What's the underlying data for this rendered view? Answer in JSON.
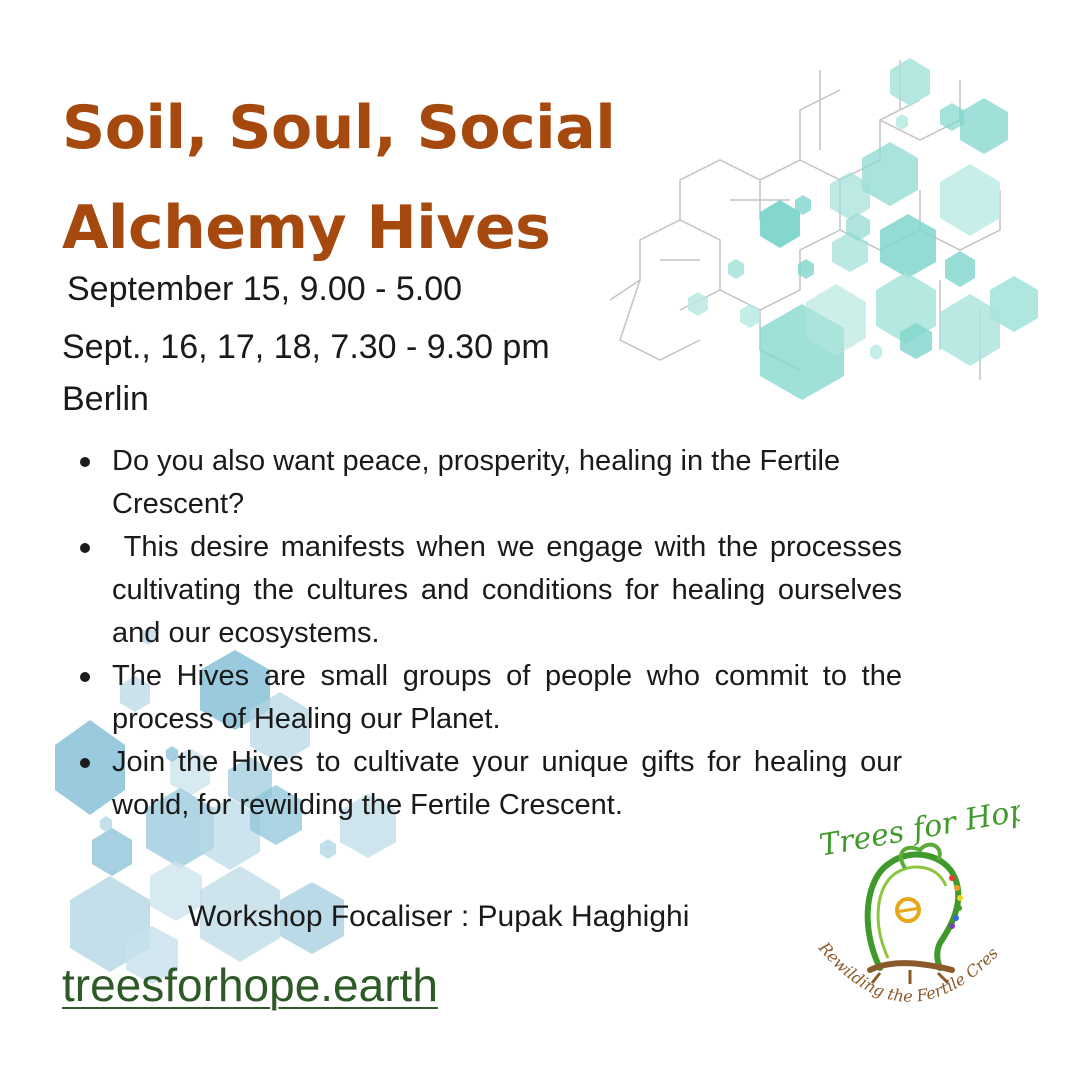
{
  "title": {
    "line1": "Soil, Soul, Social",
    "line2": "Alchemy Hives"
  },
  "schedule": {
    "date1": "September 15, 9.00 - 5.00",
    "date2": "Sept., 16, 17, 18, 7.30 - 9.30 pm",
    "city": "Berlin"
  },
  "bullets": [
    "Do you also want peace, prosperity, healing in the Fertile Crescent?",
    " This desire manifests when we engage with the processes cultivating the cultures and conditions for healing ourselves and our ecosystems.",
    "The Hives are small groups of people who commit to the process of Healing our Planet.",
    "Join the Hives to cultivate your unique gifts for healing our world, for rewilding the Fertile Crescent."
  ],
  "focaliser": "Workshop Focaliser : Pupak Haghighi",
  "website": "treesforhope.earth",
  "logo": {
    "top_text": "Trees for Hope",
    "bottom_text": "Rewilding the Fertile Crescent",
    "icon": "tree-head-icon"
  },
  "colors": {
    "title": "#a6490f",
    "link": "#2d5a27",
    "hex_teal": "#7fd6cc",
    "hex_blue": "#8ec4d9",
    "logo_green": "#3f9a2b",
    "logo_brown": "#8b5a2b"
  }
}
